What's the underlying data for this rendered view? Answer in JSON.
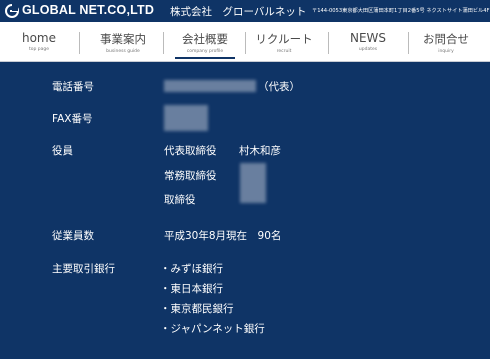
{
  "header": {
    "brand": "GLOBAL NET.CO,LTD",
    "brand_jp": "株式会社　グローバルネット",
    "address": "〒144-0053東京都大田区蒲田本町1丁目2番5号 ネクストサイト蒲田ビル4F",
    "logo_icon": "globalnet-logo-icon"
  },
  "nav": {
    "items": [
      {
        "label": "home",
        "sub": "top page"
      },
      {
        "label": "事業案内",
        "sub": "business guide"
      },
      {
        "label": "会社概要",
        "sub": "company profile"
      },
      {
        "label": "リクルート",
        "sub": "recruit"
      },
      {
        "label": "NEWS",
        "sub": "updates"
      },
      {
        "label": "お問合せ",
        "sub": "inquiry"
      }
    ],
    "active_index": 2
  },
  "profile": {
    "phone": {
      "label": "電話番号",
      "suffix": "（代表）"
    },
    "fax": {
      "label": "FAX番号"
    },
    "officers": {
      "label": "役員",
      "rows": [
        {
          "title": "代表取締役",
          "name": "村木和彦"
        },
        {
          "title": "常務取締役"
        },
        {
          "title": "取締役"
        }
      ]
    },
    "employees": {
      "label": "従業員数",
      "value": "平成30年8月現在　90名"
    },
    "banks": {
      "label": "主要取引銀行",
      "items": [
        "・みずほ銀行",
        "・東日本銀行",
        "・東京都民銀行",
        "・ジャパンネット銀行"
      ]
    }
  },
  "colors": {
    "navy": "#0f3466",
    "nav_bg": "#ffffff",
    "text": "#ffffff"
  }
}
